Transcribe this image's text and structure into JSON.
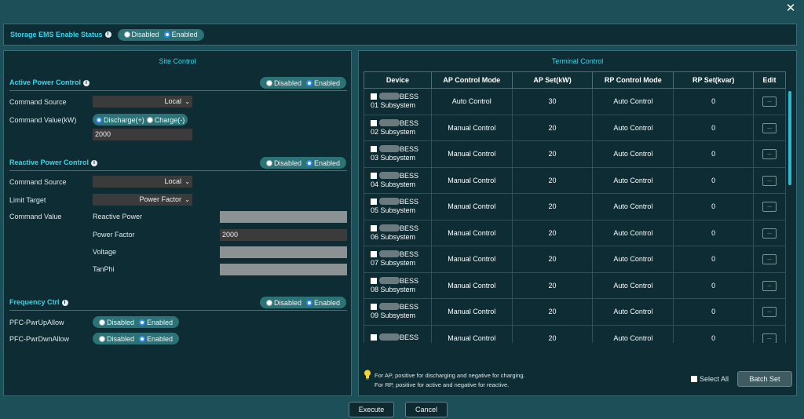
{
  "close_glyph": "✕",
  "storage": {
    "label": "Storage EMS Enable Status",
    "disabled": "Disabled",
    "enabled": "Enabled"
  },
  "site": {
    "title": "Site Control",
    "active": {
      "title": "Active Power Control",
      "disabled": "Disabled",
      "enabled": "Enabled",
      "command_source_label": "Command Source",
      "command_source_value": "Local",
      "command_value_label": "Command Value(kW)",
      "discharge": "Discharge(+)",
      "charge": "Charge(-)",
      "value": "2000"
    },
    "reactive": {
      "title": "Reactive Power Control",
      "disabled": "Disabled",
      "enabled": "Enabled",
      "command_source_label": "Command Source",
      "command_source_value": "Local",
      "limit_target_label": "Limit Target",
      "limit_target_value": "Power Factor",
      "command_value_label": "Command Value",
      "reactive_power_label": "Reactive Power",
      "power_factor_label": "Power Factor",
      "power_factor_value": "2000",
      "voltage_label": "Voltage",
      "tanphi_label": "TanPhi"
    },
    "frequency": {
      "title": "Frequency Ctrl",
      "disabled": "Disabled",
      "enabled": "Enabled",
      "up_label": "PFC-PwrUpAllow",
      "down_label": "PFC-PwrDwnAllow",
      "opt_disabled": "Disabled",
      "opt_enabled": "Enabled"
    }
  },
  "terminal": {
    "title": "Terminal Control",
    "columns": [
      "Device",
      "AP Control Mode",
      "AP Set(kW)",
      "RP Control Mode",
      "RP Set(kvar)",
      "Edit"
    ],
    "rows": [
      {
        "dev1": "BESS",
        "dev2": "01 Subsystem",
        "ap_mode": "Auto Control",
        "ap_set": "30",
        "rp_mode": "Auto Control",
        "rp_set": "0",
        "edit": "..."
      },
      {
        "dev1": "BESS",
        "dev2": "02 Subsystem",
        "ap_mode": "Manual Control",
        "ap_set": "20",
        "rp_mode": "Auto Control",
        "rp_set": "0",
        "edit": "..."
      },
      {
        "dev1": "BESS",
        "dev2": "03 Subsystem",
        "ap_mode": "Manual Control",
        "ap_set": "20",
        "rp_mode": "Auto Control",
        "rp_set": "0",
        "edit": "..."
      },
      {
        "dev1": "BESS",
        "dev2": "04 Subsystem",
        "ap_mode": "Manual Control",
        "ap_set": "20",
        "rp_mode": "Auto Control",
        "rp_set": "0",
        "edit": "..."
      },
      {
        "dev1": "BESS",
        "dev2": "05 Subsystem",
        "ap_mode": "Manual Control",
        "ap_set": "20",
        "rp_mode": "Auto Control",
        "rp_set": "0",
        "edit": "..."
      },
      {
        "dev1": "BESS",
        "dev2": "06 Subsystem",
        "ap_mode": "Manual Control",
        "ap_set": "20",
        "rp_mode": "Auto Control",
        "rp_set": "0",
        "edit": "..."
      },
      {
        "dev1": "BESS",
        "dev2": "07 Subsystem",
        "ap_mode": "Manual Control",
        "ap_set": "20",
        "rp_mode": "Auto Control",
        "rp_set": "0",
        "edit": "..."
      },
      {
        "dev1": "BESS",
        "dev2": "08 Subsystem",
        "ap_mode": "Manual Control",
        "ap_set": "20",
        "rp_mode": "Auto Control",
        "rp_set": "0",
        "edit": "..."
      },
      {
        "dev1": "BESS",
        "dev2": "09 Subsystem",
        "ap_mode": "Manual Control",
        "ap_set": "20",
        "rp_mode": "Auto Control",
        "rp_set": "0",
        "edit": "..."
      },
      {
        "dev1": "BESS",
        "dev2": "",
        "ap_mode": "Manual Control",
        "ap_set": "20",
        "rp_mode": "Auto Control",
        "rp_set": "0",
        "edit": "..."
      }
    ],
    "note_line1": "For AP, positive for discharging and negative for charging.",
    "note_line2": "For RP, positive for active and negative for reactive.",
    "select_all": "Select All",
    "batch_set": "Batch Set"
  },
  "footer": {
    "execute": "Execute",
    "cancel": "Cancel"
  },
  "colors": {
    "background": "#1d4f58",
    "panel": "#0d2c33",
    "accent": "#38d6ec",
    "toggle": "#2b7377"
  },
  "icons": [
    "close-icon",
    "info-icon",
    "lightbulb-icon",
    "chevron-down-icon"
  ]
}
